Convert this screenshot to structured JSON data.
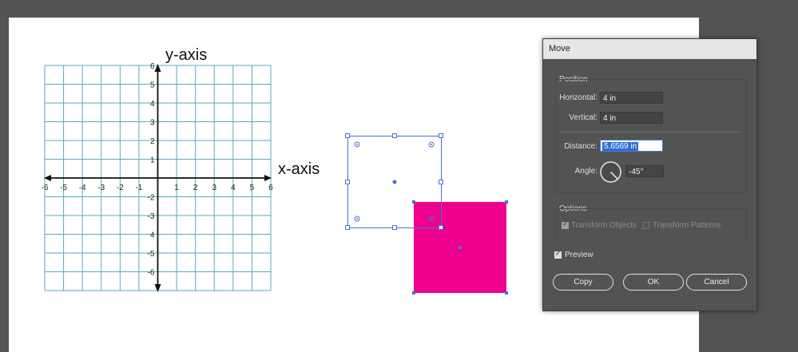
{
  "artboard": {
    "graph": {
      "y_axis_title": "y-axis",
      "x_axis_title": "x-axis",
      "x_tick_labels": [
        "-6",
        "-5",
        "-4",
        "-3",
        "-2",
        "-1",
        "1",
        "2",
        "3",
        "4",
        "5",
        "6"
      ],
      "y_tick_labels": [
        "6",
        "5",
        "4",
        "3",
        "2",
        "1",
        "-2",
        "-3",
        "4",
        "-5",
        "-6"
      ],
      "grid_color": "#5aa9bb"
    },
    "shapes": {
      "fill_color": "#ec008c",
      "selection_color": "#4d6fd6"
    }
  },
  "dialog": {
    "title": "Move",
    "position_label": "Position",
    "horizontal_label": "Horizontal:",
    "horizontal_value": "4 in",
    "vertical_label": "Vertical:",
    "vertical_value": "4 in",
    "distance_label": "Distance:",
    "distance_value": "5.6569 in",
    "angle_label": "Angle:",
    "angle_value": "-45°",
    "options_label": "Options",
    "transform_objects_label": "Transform Objects",
    "transform_patterns_label": "Transform Patterns",
    "preview_label": "Preview",
    "copy_label": "Copy",
    "ok_label": "OK",
    "cancel_label": "Cancel"
  }
}
